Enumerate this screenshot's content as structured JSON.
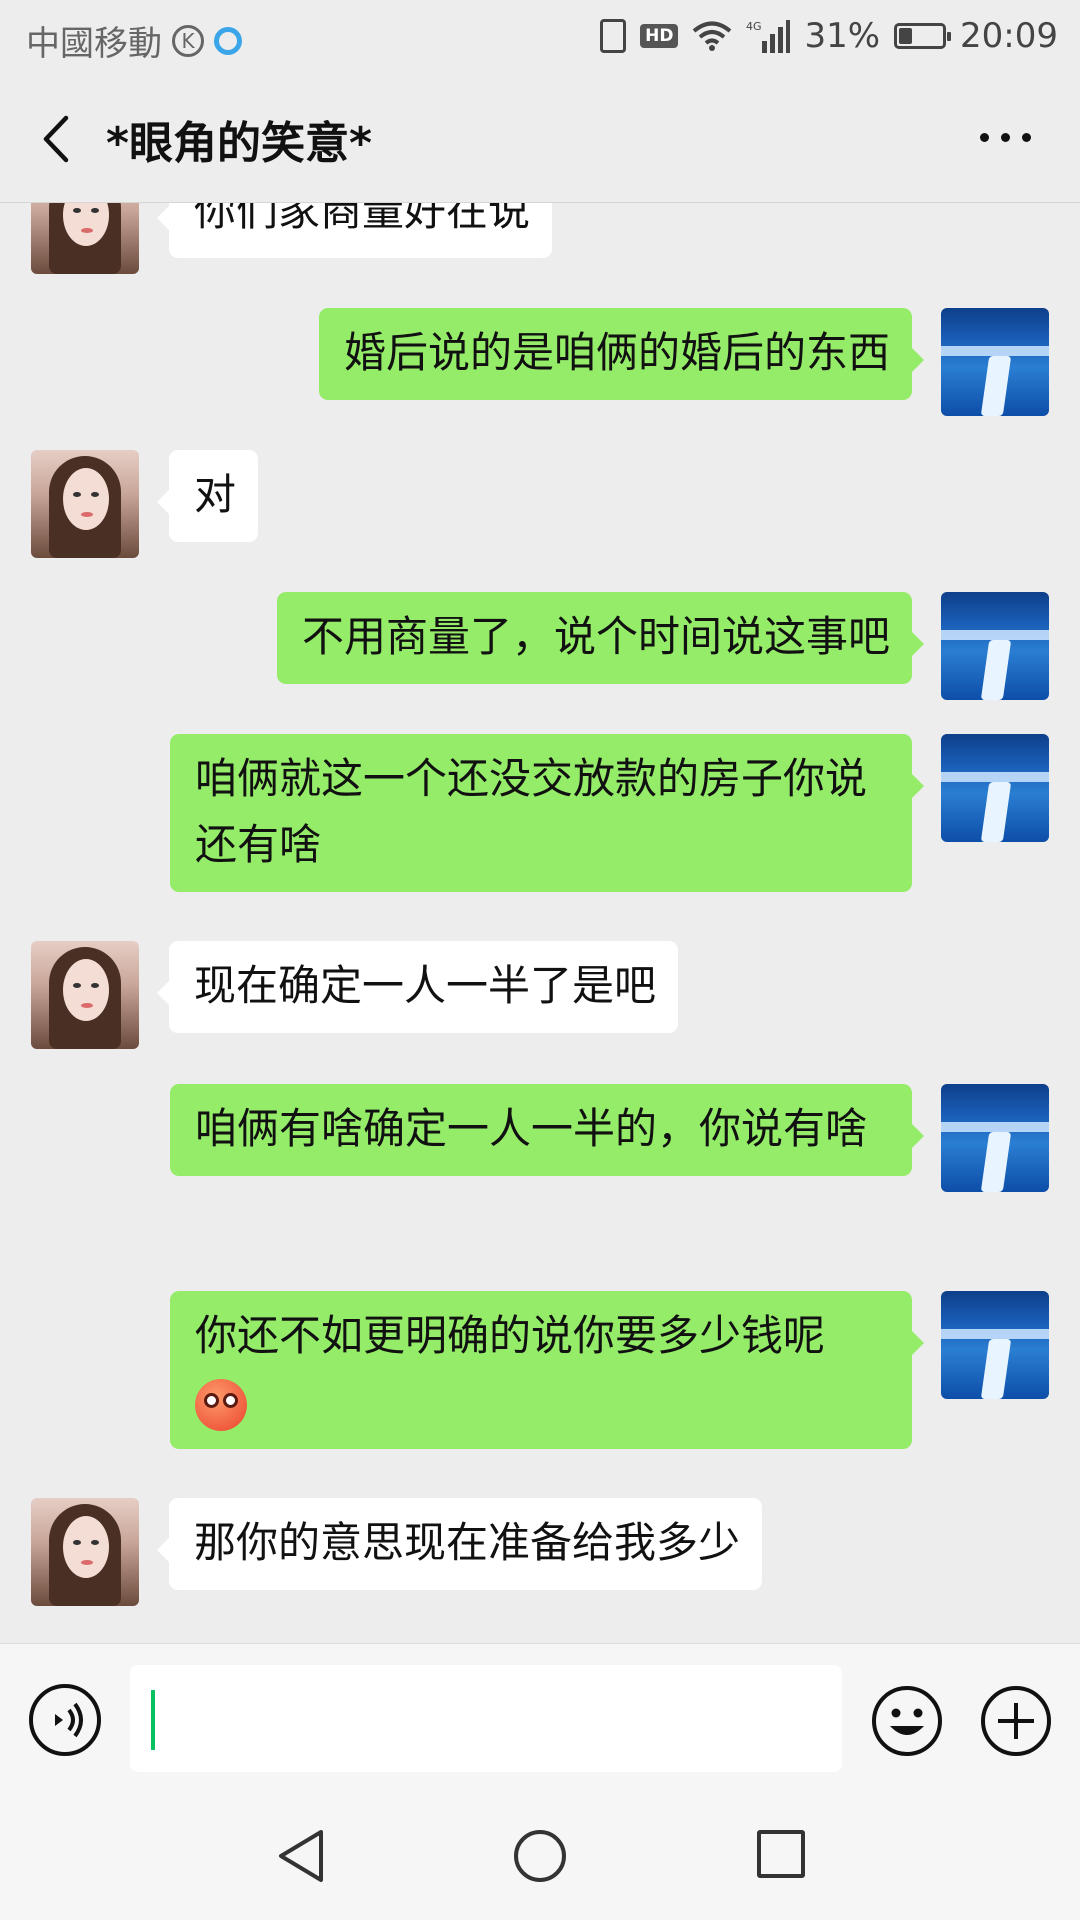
{
  "status_bar": {
    "carrier": "中國移動",
    "k_badge": "K",
    "network": "4G",
    "battery": "31%",
    "battery_level": 0.31,
    "time": "20:09"
  },
  "header": {
    "title": "*眼角的笑意*"
  },
  "messages": [
    {
      "side": "in",
      "text": "你们家商量好在说"
    },
    {
      "side": "out",
      "text": "婚后说的是咱俩的婚后的东西"
    },
    {
      "side": "in",
      "text": "对"
    },
    {
      "side": "out",
      "text": "不用商量了，说个时间说这事吧"
    },
    {
      "side": "out",
      "text": "咱俩就这一个还没交放款的房子你说还有啥"
    },
    {
      "side": "in",
      "text": "现在确定一人一半了是吧"
    },
    {
      "side": "out",
      "text": "咱俩有啥确定一人一半的，你说有啥"
    },
    {
      "side": "out",
      "text": "你还不如更明确的说你要多少钱呢",
      "emoji": "flushed-face-icon"
    },
    {
      "side": "in",
      "text": "那你的意思现在准备给我多少"
    }
  ],
  "input": {
    "value": ""
  },
  "icons": {
    "voice": "voice-icon",
    "emoji": "emoji-icon",
    "plus": "plus-icon",
    "back": "back-icon",
    "more": "more-icon"
  },
  "colors": {
    "outgoing_bubble": "#95ec69",
    "incoming_bubble": "#ffffff",
    "background": "#ededed",
    "cursor": "#07c160"
  }
}
